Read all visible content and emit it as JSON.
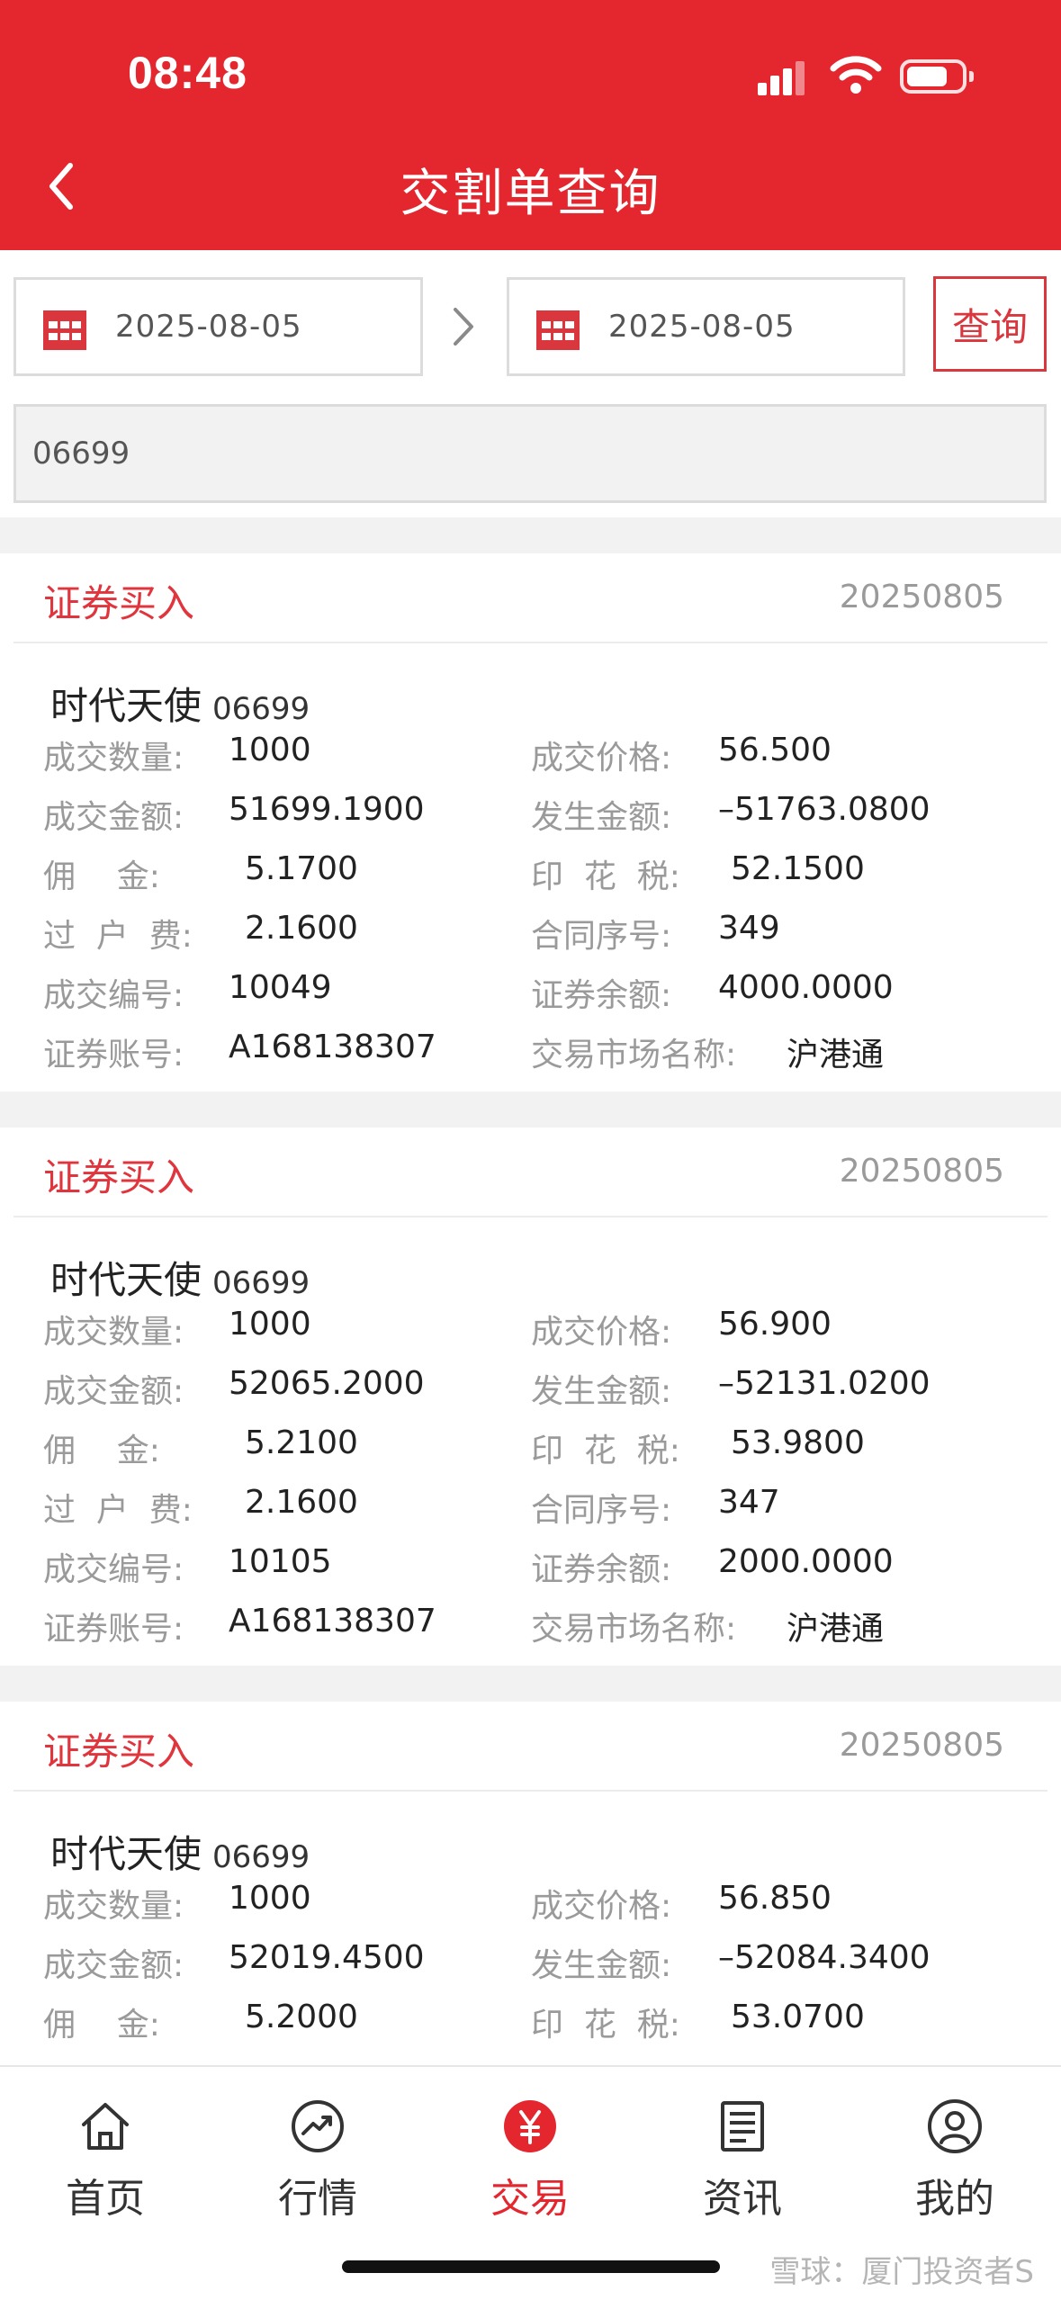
{
  "status_bar": {
    "time": "08:48"
  },
  "header": {
    "title": "交割单查询"
  },
  "filter": {
    "start_date": "2025-08-05",
    "end_date": "2025-08-05",
    "query_label": "查询",
    "code_value": "06699"
  },
  "labels": {
    "qty": "成交数量:",
    "price": "成交价格:",
    "amount": "成交金额:",
    "occur": "发生金额:",
    "commission": "佣    金:",
    "stamp": "印  花  税:",
    "transfer": "过  户  费:",
    "contract": "合同序号:",
    "deal_no": "成交编号:",
    "balance": "证券余额:",
    "account": "证券账号:",
    "market": "交易市场名称:"
  },
  "records": [
    {
      "type": "证券买入",
      "date": "20250805",
      "name": "时代天使",
      "code": "06699",
      "qty": "1000",
      "price": "56.500",
      "amount": "51699.1900",
      "occur": "–51763.0800",
      "commission": "5.1700",
      "stamp": "52.1500",
      "transfer": "2.1600",
      "contract": "349",
      "deal_no": "10049",
      "balance": "4000.0000",
      "account": "A168138307",
      "market": "沪港通"
    },
    {
      "type": "证券买入",
      "date": "20250805",
      "name": "时代天使",
      "code": "06699",
      "qty": "1000",
      "price": "56.900",
      "amount": "52065.2000",
      "occur": "–52131.0200",
      "commission": "5.2100",
      "stamp": "53.9800",
      "transfer": "2.1600",
      "contract": "347",
      "deal_no": "10105",
      "balance": "2000.0000",
      "account": "A168138307",
      "market": "沪港通"
    },
    {
      "type": "证券买入",
      "date": "20250805",
      "name": "时代天使",
      "code": "06699",
      "qty": "1000",
      "price": "56.850",
      "amount": "52019.4500",
      "occur": "–52084.3400",
      "commission": "5.2000",
      "stamp": "53.0700"
    }
  ],
  "tabs": [
    {
      "label": "首页",
      "icon": "home-icon"
    },
    {
      "label": "行情",
      "icon": "market-trend-icon"
    },
    {
      "label": "交易",
      "icon": "yen-icon"
    },
    {
      "label": "资讯",
      "icon": "news-icon"
    },
    {
      "label": "我的",
      "icon": "profile-icon"
    }
  ],
  "colors": {
    "brand_red": "#e4262e",
    "label_gray": "#9a9a9a"
  },
  "watermark": "雪球：厦门投资者S"
}
